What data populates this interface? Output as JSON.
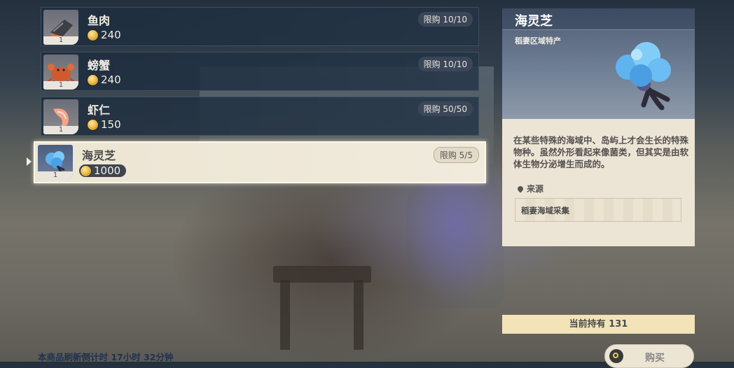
{
  "shop_items": [
    {
      "name": "鱼肉",
      "price": "240",
      "limit": "限购 10/10",
      "qty": "1",
      "icon": "fish-meat-icon"
    },
    {
      "name": "螃蟹",
      "price": "240",
      "limit": "限购 10/10",
      "qty": "1",
      "icon": "crab-icon"
    },
    {
      "name": "虾仁",
      "price": "150",
      "limit": "限购 50/50",
      "qty": "1",
      "icon": "shrimp-icon"
    },
    {
      "name": "海灵芝",
      "price": "1000",
      "limit": "限购 5/5",
      "qty": "1",
      "icon": "sea-ganoderma-icon"
    }
  ],
  "detail": {
    "title": "海灵芝",
    "subtitle": "稻妻区域特产",
    "description": "在某些特殊的海域中、岛屿上才会生长的特殊物种。虽然外形看起来像菌类，但其实是由软体生物分泌增生而成的。",
    "source_label": "来源",
    "source_value": "稻妻海域采集"
  },
  "holding_text": "当前持有 131",
  "buy_label": "购买",
  "refresh_text": "本商品刷新倒计时 17小时 32分钟",
  "colors": {
    "selected_bg": "#ece5d3",
    "row_bg": "#1e2d3e",
    "accent_gold": "#e8b33a"
  }
}
